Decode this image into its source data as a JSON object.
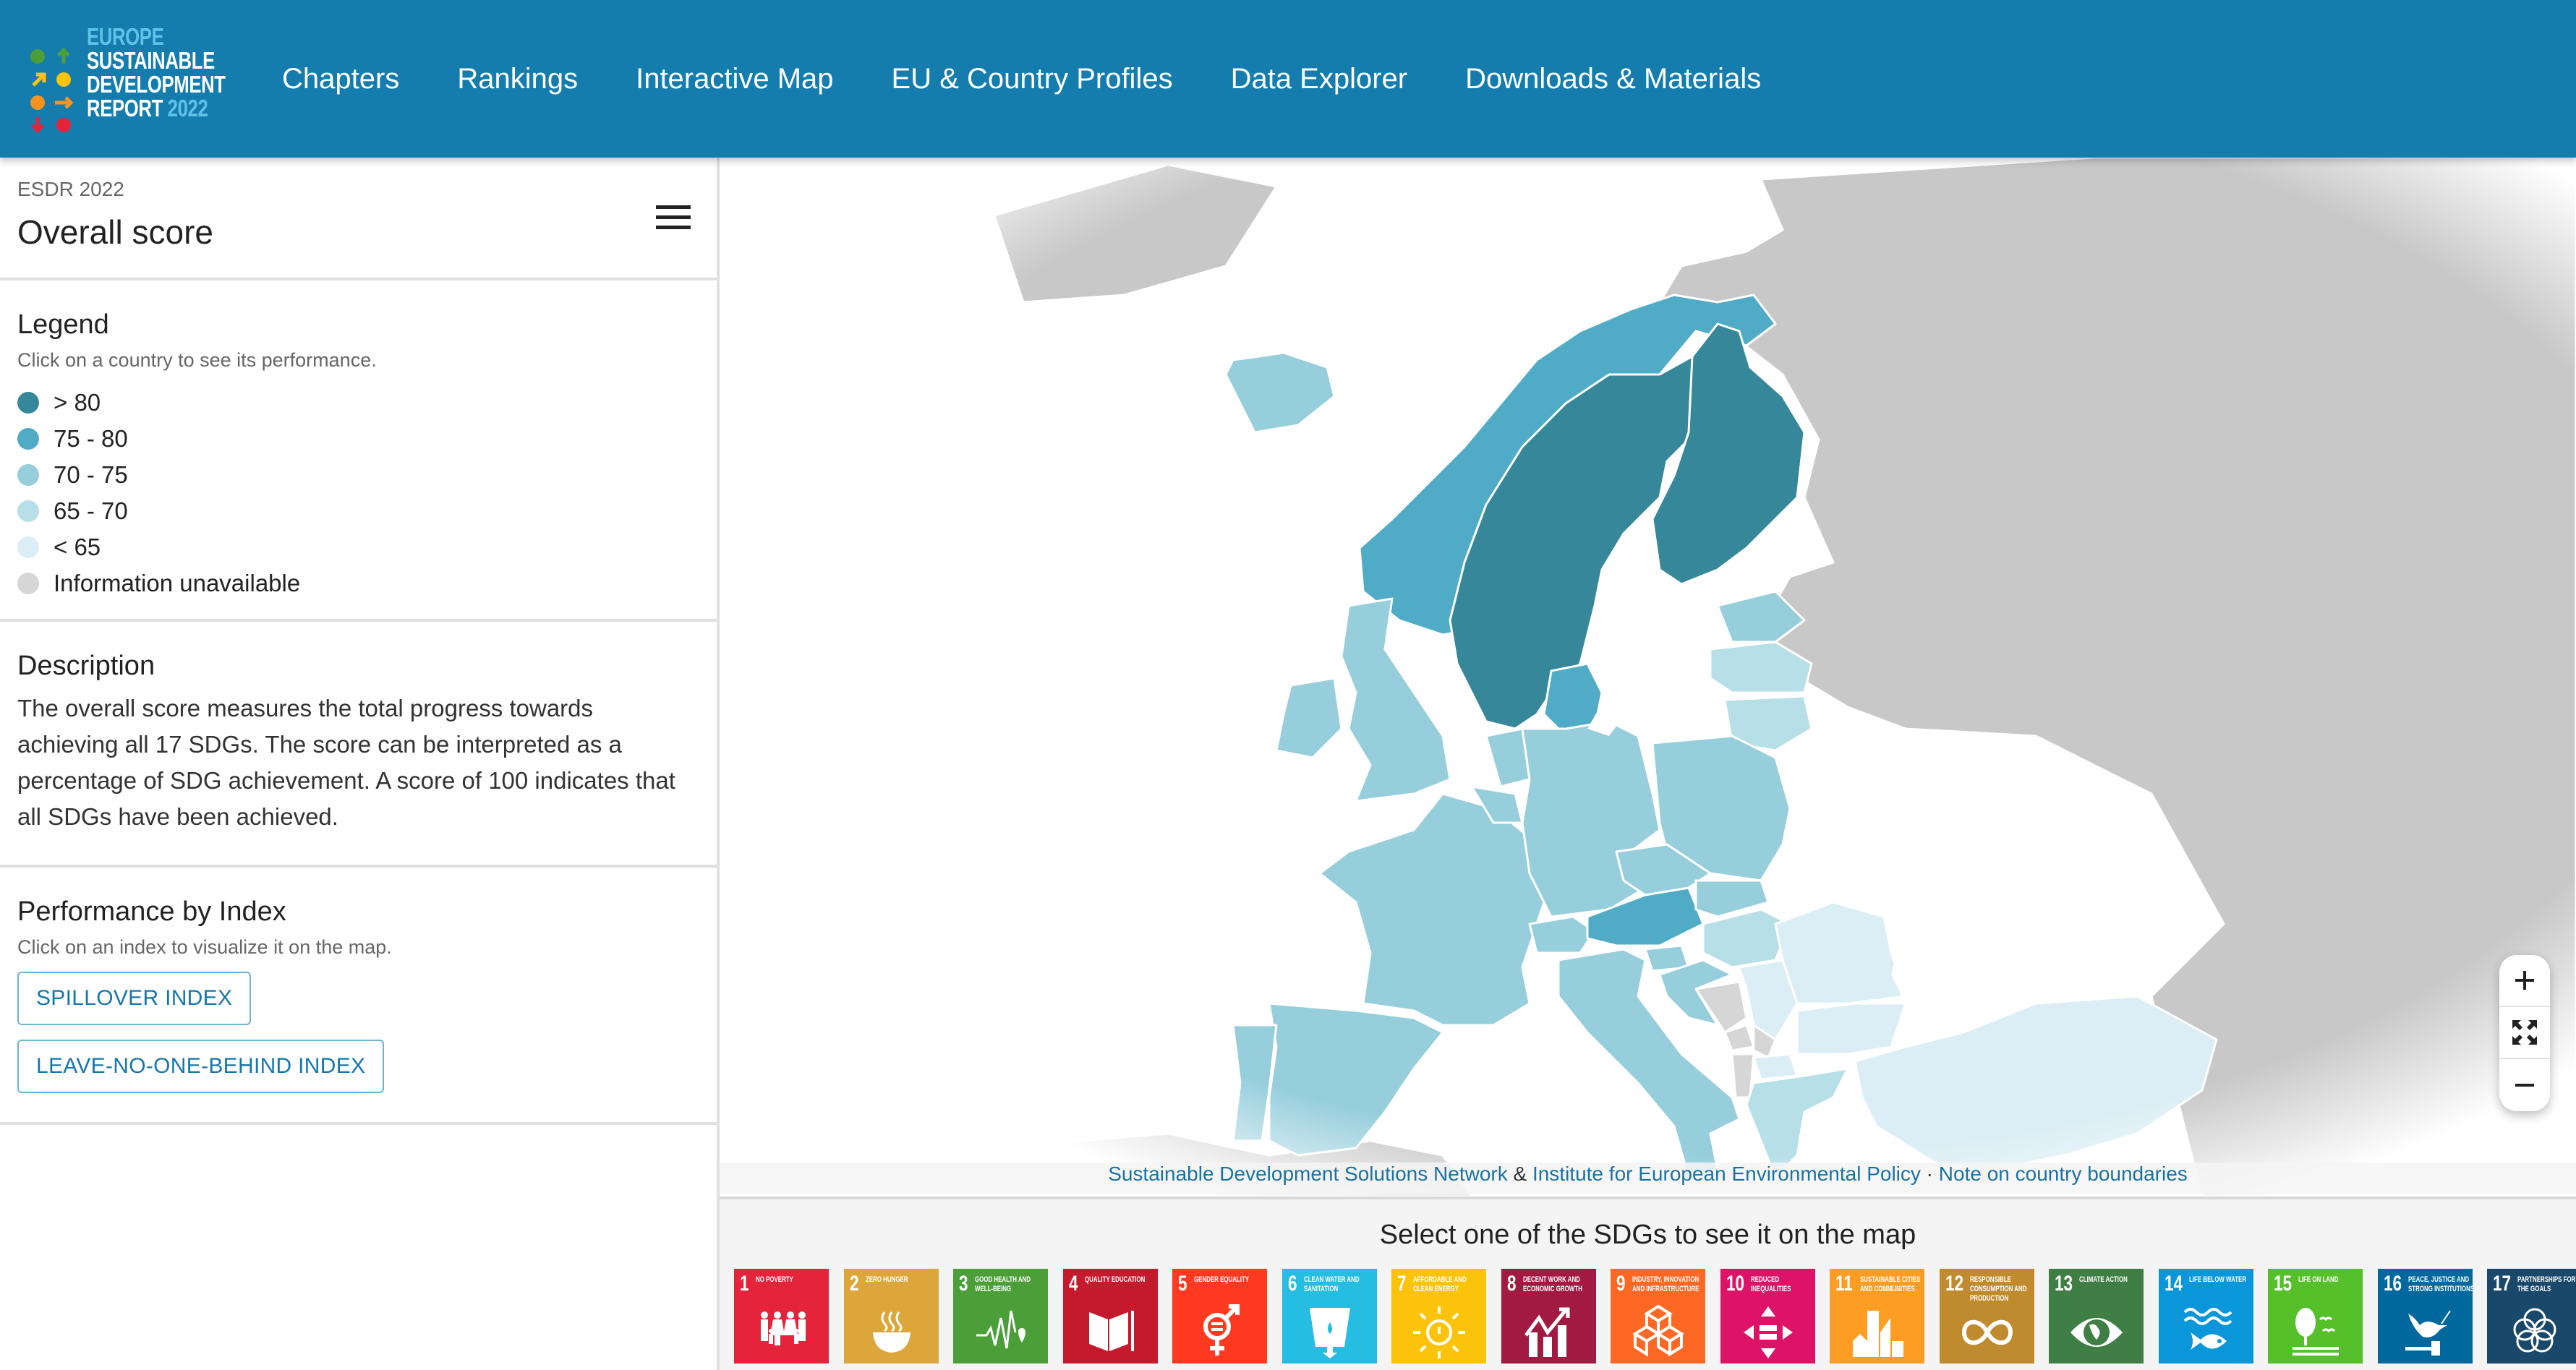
{
  "header": {
    "logo": {
      "line1": "EUROPE",
      "line2": "SUSTAINABLE",
      "line3": "DEVELOPMENT",
      "line4": "REPORT",
      "year": "2022"
    },
    "nav": [
      "Chapters",
      "Rankings",
      "Interactive Map",
      "EU & Country Profiles",
      "Data Explorer",
      "Downloads & Materials"
    ]
  },
  "sidebar": {
    "kicker": "ESDR 2022",
    "title": "Overall score",
    "menu_icon": "hamburger-menu-icon",
    "legend": {
      "title": "Legend",
      "subtitle": "Click on a country to see its performance.",
      "items": [
        {
          "label": "> 80",
          "color": "#36879a"
        },
        {
          "label": "75 - 80",
          "color": "#50acc6"
        },
        {
          "label": "70 - 75",
          "color": "#96cedc"
        },
        {
          "label": "65 - 70",
          "color": "#b7dfe8"
        },
        {
          "label": "< 65",
          "color": "#dbeef5"
        },
        {
          "label": "Information unavailable",
          "color": "#d6d6d6"
        }
      ]
    },
    "description": {
      "title": "Description",
      "text": "The overall score measures the total progress towards achieving all 17 SDGs. The score can be interpreted as a percentage of SDG achievement. A score of 100 indicates that all SDGs have been achieved."
    },
    "performance": {
      "title": "Performance by Index",
      "subtitle": "Click on an index to visualize it on the map.",
      "buttons": [
        "SPILLOVER INDEX",
        "LEAVE-NO-ONE-BEHIND INDEX"
      ]
    }
  },
  "map": {
    "outside_color": "#c8c8c8",
    "countries": [
      {
        "name": "Finland",
        "category": "> 80"
      },
      {
        "name": "Sweden",
        "category": "> 80"
      },
      {
        "name": "Norway",
        "category": "75 - 80"
      },
      {
        "name": "Denmark",
        "category": "75 - 80"
      },
      {
        "name": "Austria",
        "category": "75 - 80"
      },
      {
        "name": "Iceland",
        "category": "70 - 75"
      },
      {
        "name": "Estonia",
        "category": "70 - 75"
      },
      {
        "name": "Ireland",
        "category": "70 - 75"
      },
      {
        "name": "United Kingdom",
        "category": "70 - 75"
      },
      {
        "name": "France",
        "category": "70 - 75"
      },
      {
        "name": "Spain",
        "category": "70 - 75"
      },
      {
        "name": "Portugal",
        "category": "70 - 75"
      },
      {
        "name": "Germany",
        "category": "70 - 75"
      },
      {
        "name": "Netherlands",
        "category": "70 - 75"
      },
      {
        "name": "Belgium",
        "category": "70 - 75"
      },
      {
        "name": "Switzerland",
        "category": "70 - 75"
      },
      {
        "name": "Italy",
        "category": "70 - 75"
      },
      {
        "name": "Poland",
        "category": "70 - 75"
      },
      {
        "name": "Czechia",
        "category": "70 - 75"
      },
      {
        "name": "Slovakia",
        "category": "70 - 75"
      },
      {
        "name": "Slovenia",
        "category": "70 - 75"
      },
      {
        "name": "Croatia",
        "category": "70 - 75"
      },
      {
        "name": "Latvia",
        "category": "65 - 70"
      },
      {
        "name": "Lithuania",
        "category": "65 - 70"
      },
      {
        "name": "Hungary",
        "category": "65 - 70"
      },
      {
        "name": "Greece",
        "category": "65 - 70"
      },
      {
        "name": "Romania",
        "category": "< 65"
      },
      {
        "name": "Bulgaria",
        "category": "< 65"
      },
      {
        "name": "Serbia",
        "category": "< 65"
      },
      {
        "name": "North Macedonia",
        "category": "< 65"
      },
      {
        "name": "Turkey",
        "category": "< 65"
      },
      {
        "name": "Bosnia and Herzegovina",
        "category": "Information unavailable"
      },
      {
        "name": "Montenegro",
        "category": "Information unavailable"
      },
      {
        "name": "Albania",
        "category": "Information unavailable"
      },
      {
        "name": "Kosovo",
        "category": "Information unavailable"
      }
    ],
    "attribution": {
      "link1": "Sustainable Development Solutions Network",
      "amp": " & ",
      "link2": "Institute for European Environmental Policy",
      "sep": " · ",
      "link3": "Note on country boundaries"
    },
    "zoom_controls": {
      "zoom_in": "zoom-in-icon",
      "fit": "fullscreen-expand-icon",
      "zoom_out": "zoom-out-icon"
    }
  },
  "sdg_section": {
    "title": "Select one of the SDGs to see it on the map",
    "goals": [
      {
        "num": "1",
        "name": "No Poverty",
        "color": "#e5243b",
        "icon": "family-icon"
      },
      {
        "num": "2",
        "name": "Zero Hunger",
        "color": "#dda63a",
        "icon": "bowl-icon"
      },
      {
        "num": "3",
        "name": "Good Health and Well-Being",
        "color": "#4c9f38",
        "icon": "heartbeat-icon"
      },
      {
        "num": "4",
        "name": "Quality Education",
        "color": "#c5192d",
        "icon": "book-icon"
      },
      {
        "num": "5",
        "name": "Gender Equality",
        "color": "#ff3a21",
        "icon": "gender-equality-icon"
      },
      {
        "num": "6",
        "name": "Clean Water and Sanitation",
        "color": "#26bde2",
        "icon": "water-glass-icon"
      },
      {
        "num": "7",
        "name": "Affordable and Clean Energy",
        "color": "#fcc30b",
        "icon": "sun-power-icon"
      },
      {
        "num": "8",
        "name": "Decent Work and Economic Growth",
        "color": "#a21942",
        "icon": "growth-chart-icon"
      },
      {
        "num": "9",
        "name": "Industry, Innovation and Infrastructure",
        "color": "#fd6925",
        "icon": "cubes-icon"
      },
      {
        "num": "10",
        "name": "Reduced Inequalities",
        "color": "#dd1367",
        "icon": "equality-arrows-icon"
      },
      {
        "num": "11",
        "name": "Sustainable Cities and Communities",
        "color": "#fd9d24",
        "icon": "city-buildings-icon"
      },
      {
        "num": "12",
        "name": "Responsible Consumption and Production",
        "color": "#bf8b2e",
        "icon": "infinity-icon"
      },
      {
        "num": "13",
        "name": "Climate Action",
        "color": "#3f7e44",
        "icon": "eye-globe-icon"
      },
      {
        "num": "14",
        "name": "Life Below Water",
        "color": "#0a97d9",
        "icon": "fish-icon"
      },
      {
        "num": "15",
        "name": "Life on Land",
        "color": "#56c02b",
        "icon": "tree-icon"
      },
      {
        "num": "16",
        "name": "Peace, Justice and Strong Institutions",
        "color": "#00689d",
        "icon": "dove-gavel-icon"
      },
      {
        "num": "17",
        "name": "Partnerships for the Goals",
        "color": "#19486a",
        "icon": "rings-icon"
      }
    ]
  }
}
